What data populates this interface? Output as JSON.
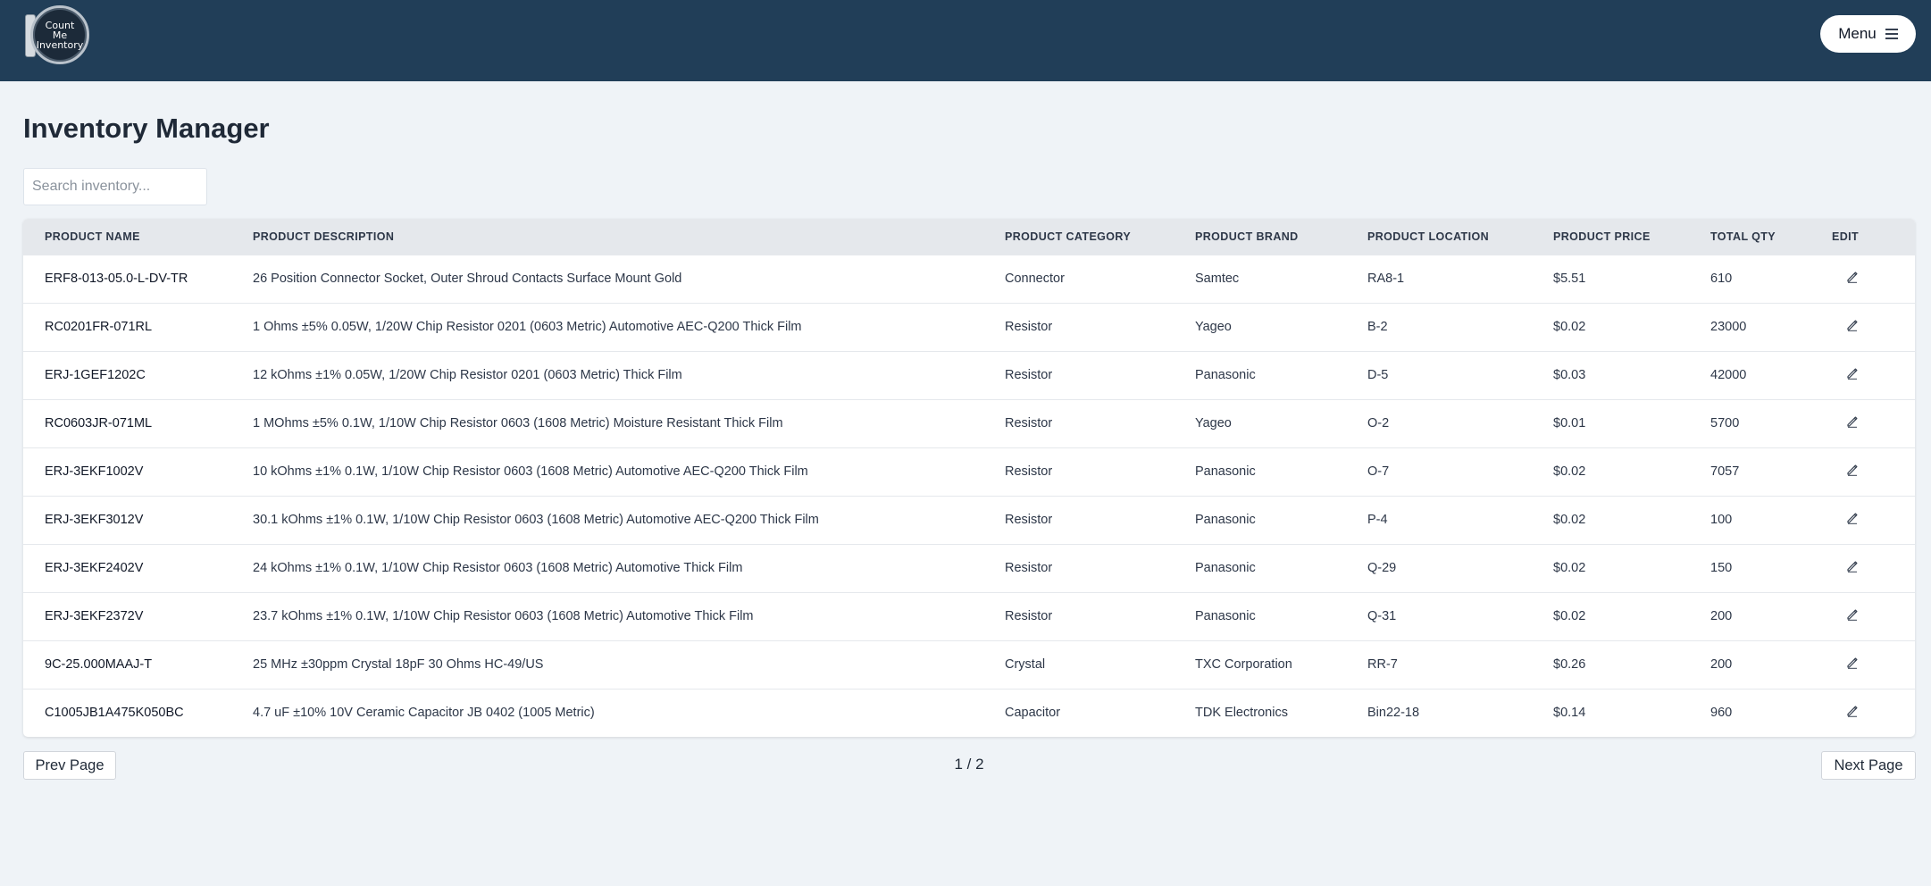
{
  "header": {
    "logo_lines": [
      "Count",
      "Me",
      "Inventory"
    ],
    "menu_label": "Menu",
    "menu_icon": "hamburger-icon",
    "colors": {
      "topbar": "#213e58",
      "page_bg": "#eff3f7"
    }
  },
  "main": {
    "title": "Inventory Manager",
    "search": {
      "placeholder": "Search inventory...",
      "value": ""
    }
  },
  "table": {
    "columns": [
      "Product Name",
      "Product Description",
      "Product Category",
      "Product Brand",
      "Product Location",
      "Product Price",
      "Total Qty",
      "Edit"
    ],
    "rows": [
      {
        "name": "ERF8-013-05.0-L-DV-TR",
        "description": "26 Position Connector Socket, Outer Shroud Contacts Surface Mount Gold",
        "category": "Connector",
        "brand": "Samtec",
        "location": "RA8-1",
        "price": "$5.51",
        "qty": "610"
      },
      {
        "name": "RC0201FR-071RL",
        "description": "1 Ohms ±5% 0.05W, 1/20W Chip Resistor 0201 (0603 Metric) Automotive AEC-Q200 Thick Film",
        "category": "Resistor",
        "brand": "Yageo",
        "location": "B-2",
        "price": "$0.02",
        "qty": "23000"
      },
      {
        "name": "ERJ-1GEF1202C",
        "description": "12 kOhms ±1% 0.05W, 1/20W Chip Resistor 0201 (0603 Metric) Thick Film",
        "category": "Resistor",
        "brand": "Panasonic",
        "location": "D-5",
        "price": "$0.03",
        "qty": "42000"
      },
      {
        "name": "RC0603JR-071ML",
        "description": "1 MOhms ±5% 0.1W, 1/10W Chip Resistor 0603 (1608 Metric) Moisture Resistant Thick Film",
        "category": "Resistor",
        "brand": "Yageo",
        "location": "O-2",
        "price": "$0.01",
        "qty": "5700"
      },
      {
        "name": "ERJ-3EKF1002V",
        "description": "10 kOhms ±1% 0.1W, 1/10W Chip Resistor 0603 (1608 Metric) Automotive AEC-Q200 Thick Film",
        "category": "Resistor",
        "brand": "Panasonic",
        "location": "O-7",
        "price": "$0.02",
        "qty": "7057"
      },
      {
        "name": "ERJ-3EKF3012V",
        "description": "30.1 kOhms ±1% 0.1W, 1/10W Chip Resistor 0603 (1608 Metric) Automotive AEC-Q200 Thick Film",
        "category": "Resistor",
        "brand": "Panasonic",
        "location": "P-4",
        "price": "$0.02",
        "qty": "100"
      },
      {
        "name": "ERJ-3EKF2402V",
        "description": "24 kOhms ±1% 0.1W, 1/10W Chip Resistor 0603 (1608 Metric) Automotive Thick Film",
        "category": "Resistor",
        "brand": "Panasonic",
        "location": "Q-29",
        "price": "$0.02",
        "qty": "150"
      },
      {
        "name": "ERJ-3EKF2372V",
        "description": "23.7 kOhms ±1% 0.1W, 1/10W Chip Resistor 0603 (1608 Metric) Automotive Thick Film",
        "category": "Resistor",
        "brand": "Panasonic",
        "location": "Q-31",
        "price": "$0.02",
        "qty": "200"
      },
      {
        "name": "9C-25.000MAAJ-T",
        "description": "25 MHz ±30ppm Crystal 18pF 30 Ohms HC-49/US",
        "category": "Crystal",
        "brand": "TXC Corporation",
        "location": "RR-7",
        "price": "$0.26",
        "qty": "200"
      },
      {
        "name": "C1005JB1A475K050BC",
        "description": "4.7 uF ±10% 10V Ceramic Capacitor JB 0402 (1005 Metric)",
        "category": "Capacitor",
        "brand": "TDK Electronics",
        "location": "Bin22-18",
        "price": "$0.14",
        "qty": "960"
      }
    ],
    "edit_icon": "pencil-icon"
  },
  "pagination": {
    "prev_label": "Prev Page",
    "next_label": "Next Page",
    "indicator": "1 / 2"
  }
}
